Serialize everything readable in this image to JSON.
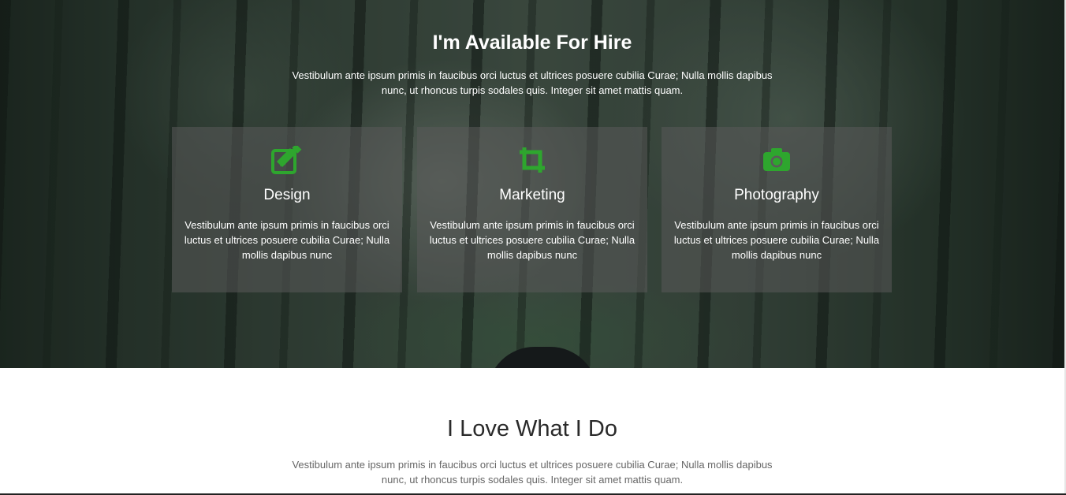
{
  "hire": {
    "title": "I'm Available For Hire",
    "text": "Vestibulum ante ipsum primis in faucibus orci luctus et ultrices posuere cubilia Curae; Nulla mollis dapibus nunc, ut rhoncus turpis sodales quis. Integer sit amet mattis quam.",
    "accent_color": "#2ea62e",
    "cards": [
      {
        "icon": "edit-icon",
        "title": "Design",
        "text": "Vestibulum ante ipsum primis in faucibus orci luctus et ultrices posuere cubilia Curae; Nulla mollis dapibus nunc"
      },
      {
        "icon": "crop-icon",
        "title": "Marketing",
        "text": "Vestibulum ante ipsum primis in faucibus orci luctus et ultrices posuere cubilia Curae; Nulla mollis dapibus nunc"
      },
      {
        "icon": "camera-icon",
        "title": "Photography",
        "text": "Vestibulum ante ipsum primis in faucibus orci luctus et ultrices posuere cubilia Curae; Nulla mollis dapibus nunc"
      }
    ]
  },
  "love": {
    "title": "I Love What I Do",
    "text": "Vestibulum ante ipsum primis in faucibus orci luctus et ultrices posuere cubilia Curae; Nulla mollis dapibus nunc, ut rhoncus turpis sodales quis. Integer sit amet mattis quam."
  }
}
